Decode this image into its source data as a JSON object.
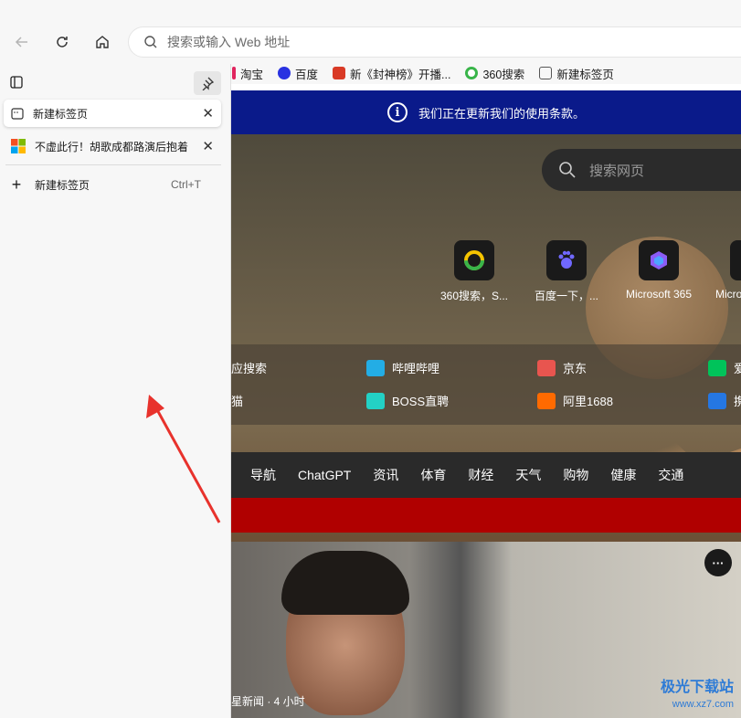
{
  "address_bar": {
    "placeholder": "搜索或输入 Web 地址"
  },
  "favorites": [
    {
      "label": "淘宝",
      "color": "#e0245e"
    },
    {
      "label": "百度",
      "color": "#2932e1"
    },
    {
      "label": "新《封神榜》开播...",
      "color": "#d93a26"
    },
    {
      "label": "360搜索",
      "color": "#39b54a"
    },
    {
      "label": "新建标签页",
      "color": "#555555"
    }
  ],
  "tabs": [
    {
      "title": "新建标签页",
      "close": "✕"
    },
    {
      "title": "不虚此行！胡歌成都路演后抱着",
      "close": "✕"
    }
  ],
  "new_tab": {
    "label": "新建标签页",
    "shortcut": "Ctrl+T"
  },
  "banner": {
    "text": "我们正在更新我们的使用条款。",
    "icon": "i"
  },
  "search": {
    "placeholder": "搜索网页"
  },
  "tiles": [
    {
      "label": "360搜索，S...",
      "icon": "360-icon"
    },
    {
      "label": "百度一下，...",
      "icon": "baidu-icon"
    },
    {
      "label": "Microsoft 365",
      "icon": "m365-icon"
    },
    {
      "label": "Micro",
      "icon": "ms-icon"
    }
  ],
  "quick_links": [
    {
      "label": "应搜索",
      "color": "#3a76d6"
    },
    {
      "label": "哔哩哔哩",
      "color": "#23ade5"
    },
    {
      "label": "京东",
      "color": "#e8554f"
    },
    {
      "label": "爱",
      "color": "#00c35a"
    },
    {
      "label": "猫",
      "color": "#ff5000"
    },
    {
      "label": "BOSS直聘",
      "color": "#23d1c5"
    },
    {
      "label": "阿里1688",
      "color": "#ff6a00"
    },
    {
      "label": "携",
      "color": "#2577e3"
    }
  ],
  "categories": [
    "导航",
    "ChatGPT",
    "资讯",
    "体育",
    "财经",
    "天气",
    "购物",
    "健康",
    "交通"
  ],
  "news": {
    "source": "星新闻 · 4 小时",
    "more": "···"
  },
  "watermark": {
    "line1": "极光下载站",
    "line2": "www.xz7.com"
  }
}
